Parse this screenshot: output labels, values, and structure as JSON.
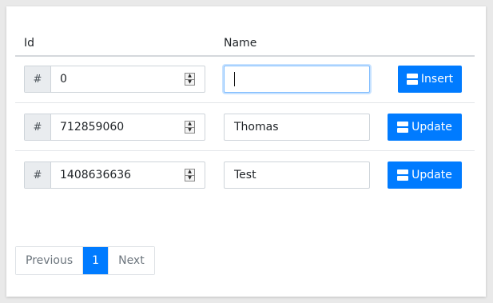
{
  "table": {
    "headers": {
      "id": "Id",
      "name": "Name"
    },
    "id_prefix": "#",
    "rows": [
      {
        "id": "0",
        "name": "",
        "action": "Insert",
        "name_focused": true
      },
      {
        "id": "712859060",
        "name": "Thomas",
        "action": "Update"
      },
      {
        "id": "1408636636",
        "name": "Test",
        "action": "Update"
      }
    ]
  },
  "pagination": {
    "previous": "Previous",
    "current": "1",
    "next": "Next"
  },
  "icons": {
    "action": "server-icon",
    "spinner_up": "spinner-up-icon",
    "spinner_down": "spinner-down-icon"
  },
  "colors": {
    "primary": "#007bff",
    "focus_border": "#80bdff",
    "addon_bg": "#e9ecef"
  }
}
